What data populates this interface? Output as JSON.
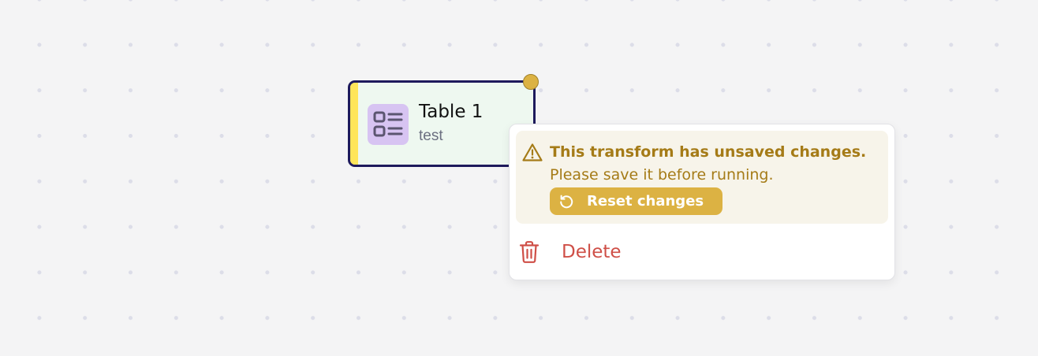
{
  "node": {
    "title": "Table 1",
    "subtitle": "test",
    "icon": "table-list-icon",
    "stripe_color": "#ffe55a",
    "border_color": "#1e1a5c",
    "status": "unsaved",
    "status_color": "#dcb243"
  },
  "popover": {
    "warning": {
      "icon": "warning-triangle-icon",
      "title": "This transform has unsaved changes.",
      "message": "Please save it before running.",
      "reset_button": {
        "icon": "reset-icon",
        "label": "Reset changes"
      },
      "color": "#a57b17"
    },
    "menu": {
      "delete": {
        "icon": "trash-icon",
        "label": "Delete",
        "color": "#cf4f47"
      }
    }
  }
}
